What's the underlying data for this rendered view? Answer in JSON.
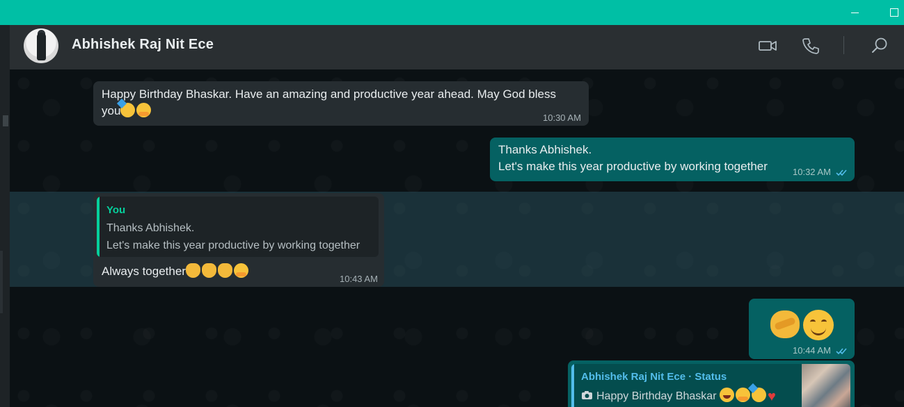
{
  "window": {
    "minimize_label": "",
    "maximize_label": ""
  },
  "header": {
    "contact_name": "Abhishek Raj Nit Ece",
    "icons": [
      "video-call-icon",
      "voice-call-icon",
      "search-icon"
    ]
  },
  "messages": [
    {
      "direction": "incoming",
      "lines": [
        "Happy Birthday Bhaskar. Have an amazing and productive year ahead. May God bless",
        "you"
      ],
      "emojis": [
        "partying-face",
        "hugging-face"
      ],
      "time": "10:30 AM"
    },
    {
      "direction": "outgoing",
      "lines": [
        "Thanks Abhishek.",
        "Let's make this year  productive by working together"
      ],
      "time": "10:32 AM",
      "status": "read"
    },
    {
      "direction": "incoming",
      "quoted": {
        "author": "You",
        "lines": [
          "Thanks Abhishek.",
          "Let's make this year  productive by working together"
        ]
      },
      "text": "Always together",
      "emojis": [
        "handshake",
        "handshake",
        "handshake",
        "hugging-face"
      ],
      "time": "10:43 AM"
    },
    {
      "direction": "outgoing",
      "emojis": [
        "handshake",
        "smiling-face"
      ],
      "time": "10:44 AM",
      "status": "read"
    },
    {
      "direction": "outgoing",
      "status_reply": {
        "author": "Abhishek Raj Nit Ece · Status",
        "text": "Happy Birthday Bhaskar",
        "emojis": [
          "laughing-face",
          "hugging-face",
          "partying-face",
          "red-heart"
        ]
      }
    }
  ],
  "colors": {
    "title_bar": "#00bfa5",
    "header_bg": "#2a2f32",
    "incoming_bubble": "#262d31",
    "outgoing_bubble": "#056162",
    "quote_accent": "#06cf9c",
    "status_accent": "#53bdeb",
    "read_ticks": "#53bdeb"
  }
}
